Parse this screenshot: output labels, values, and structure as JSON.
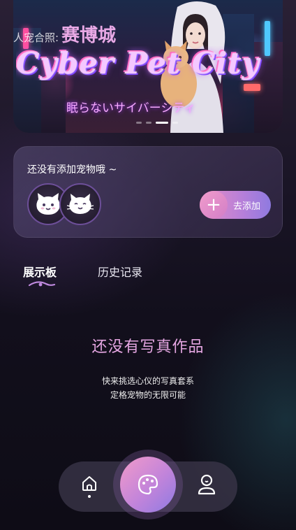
{
  "banner": {
    "caption_prefix": "人宠合照:",
    "caption_city": "赛博城",
    "title": "Cyber Pet City",
    "subtitle": "眠らないサイバーシティ",
    "page_count": 4,
    "active_page": 3
  },
  "pet_card": {
    "title": "还没有添加宠物哦 ~",
    "add_button": "去添加",
    "add_icon": "plus-icon",
    "avatars": [
      "cat-avatar-icon",
      "cat-avatar-icon"
    ]
  },
  "tabs": [
    {
      "label": "展示板",
      "active": true
    },
    {
      "label": "历史记录",
      "active": false
    }
  ],
  "empty_state": {
    "title": "还没有写真作品",
    "line1": "快来挑选心仪的写真套系",
    "line2": "定格宠物的无限可能"
  },
  "nav": {
    "items": [
      "home-icon",
      "palette-icon",
      "profile-icon"
    ],
    "active": "home-icon"
  },
  "colors": {
    "accent_pink": "#e88ec4",
    "accent_purple": "#8f7ae0",
    "empty_title": "#e5a6e2"
  }
}
